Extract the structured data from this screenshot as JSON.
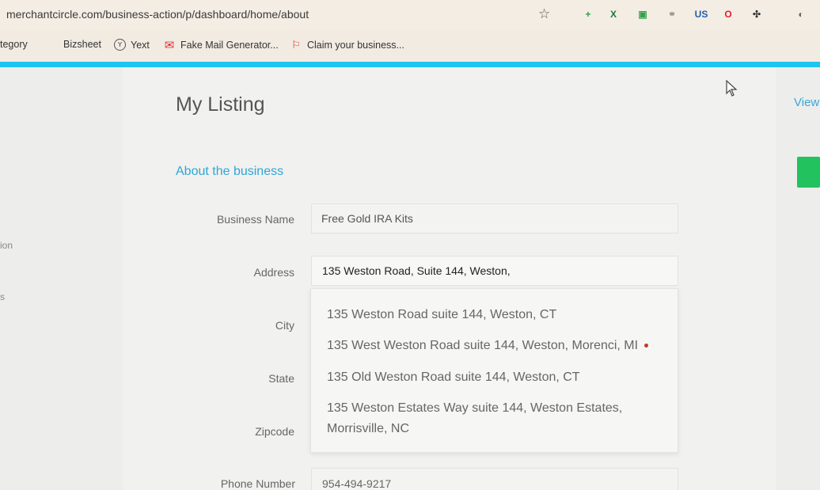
{
  "browser": {
    "url": "merchantcircle.com/business-action/p/dashboard/home/about",
    "extensions": [
      {
        "name": "plus-icon",
        "glyph": "+",
        "color": "#2e9f4a"
      },
      {
        "name": "excel-icon",
        "glyph": "X",
        "color": "#1d7a3c"
      },
      {
        "name": "screen-icon",
        "glyph": "▣",
        "color": "#35a24a"
      },
      {
        "name": "link-icon",
        "glyph": "⚭",
        "color": "#999999"
      },
      {
        "name": "vpn-us-icon",
        "glyph": "US",
        "color": "#1e5fb3"
      },
      {
        "name": "opera-icon",
        "glyph": "O",
        "color": "#e0202b"
      },
      {
        "name": "puzzle-icon",
        "glyph": "✣",
        "color": "#333333"
      },
      {
        "name": "profile-icon",
        "glyph": "◐",
        "color": "#666666"
      }
    ]
  },
  "bookmarks": {
    "category": "tegory",
    "bizsheet": "Bizsheet",
    "yext": "Yext",
    "fake_mail": "Fake Mail Generator...",
    "claim": "Claim your business..."
  },
  "page": {
    "title": "My Listing",
    "view_link": "View",
    "section": "About the business",
    "side_labels": [
      "ion",
      "s"
    ]
  },
  "form": {
    "business_name_label": "Business Name",
    "business_name_value": "Free Gold IRA Kits",
    "address_label": "Address",
    "address_value": "135 Weston Road, Suite 144, Weston,",
    "city_label": "City",
    "state_label": "State",
    "zipcode_label": "Zipcode",
    "phone_label": "Phone Number",
    "phone_value": "954-494-9217"
  },
  "suggestions": [
    "135 Weston Road suite 144, Weston, CT",
    "135 West Weston Road suite 144, Weston, Morenci, MI",
    "135 Old Weston Road suite 144, Weston, CT",
    "135 Weston Estates Way suite 144, Weston Estates,",
    "Morrisville, NC"
  ],
  "colors": {
    "accent": "#1ec5ef",
    "link": "#2fa6d6",
    "button": "#22c25f"
  }
}
